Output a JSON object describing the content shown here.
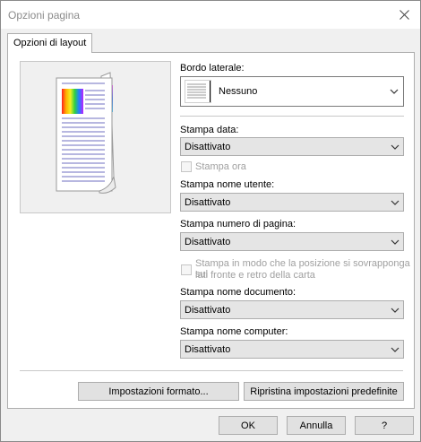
{
  "window": {
    "title": "Opzioni pagina"
  },
  "tabs": [
    {
      "label": "Opzioni di layout"
    }
  ],
  "border": {
    "label": "Bordo laterale:",
    "value": "Nessuno"
  },
  "print_date": {
    "label": "Stampa data:",
    "value": "Disattivato"
  },
  "print_time": {
    "label": "Stampa ora",
    "checked": false,
    "enabled": false
  },
  "print_user": {
    "label": "Stampa nome utente:",
    "value": "Disattivato"
  },
  "print_page_number": {
    "label": "Stampa numero di pagina:",
    "value": "Disattivato"
  },
  "overlap_position": {
    "label_line1": "Stampa in modo che la posizione si sovrapponga sui",
    "label_line2": "lati fronte e retro della carta",
    "checked": false,
    "enabled": false
  },
  "print_doc_name": {
    "label": "Stampa nome documento:",
    "value": "Disattivato"
  },
  "print_computer_name": {
    "label": "Stampa nome computer:",
    "value": "Disattivato"
  },
  "buttons": {
    "format_settings": "Impostazioni formato...",
    "restore_defaults": "Ripristina impostazioni predefinite",
    "ok": "OK",
    "cancel": "Annulla",
    "help": "?"
  },
  "icons": {
    "close": "close-icon",
    "dropdown": "chevron-down-icon"
  }
}
